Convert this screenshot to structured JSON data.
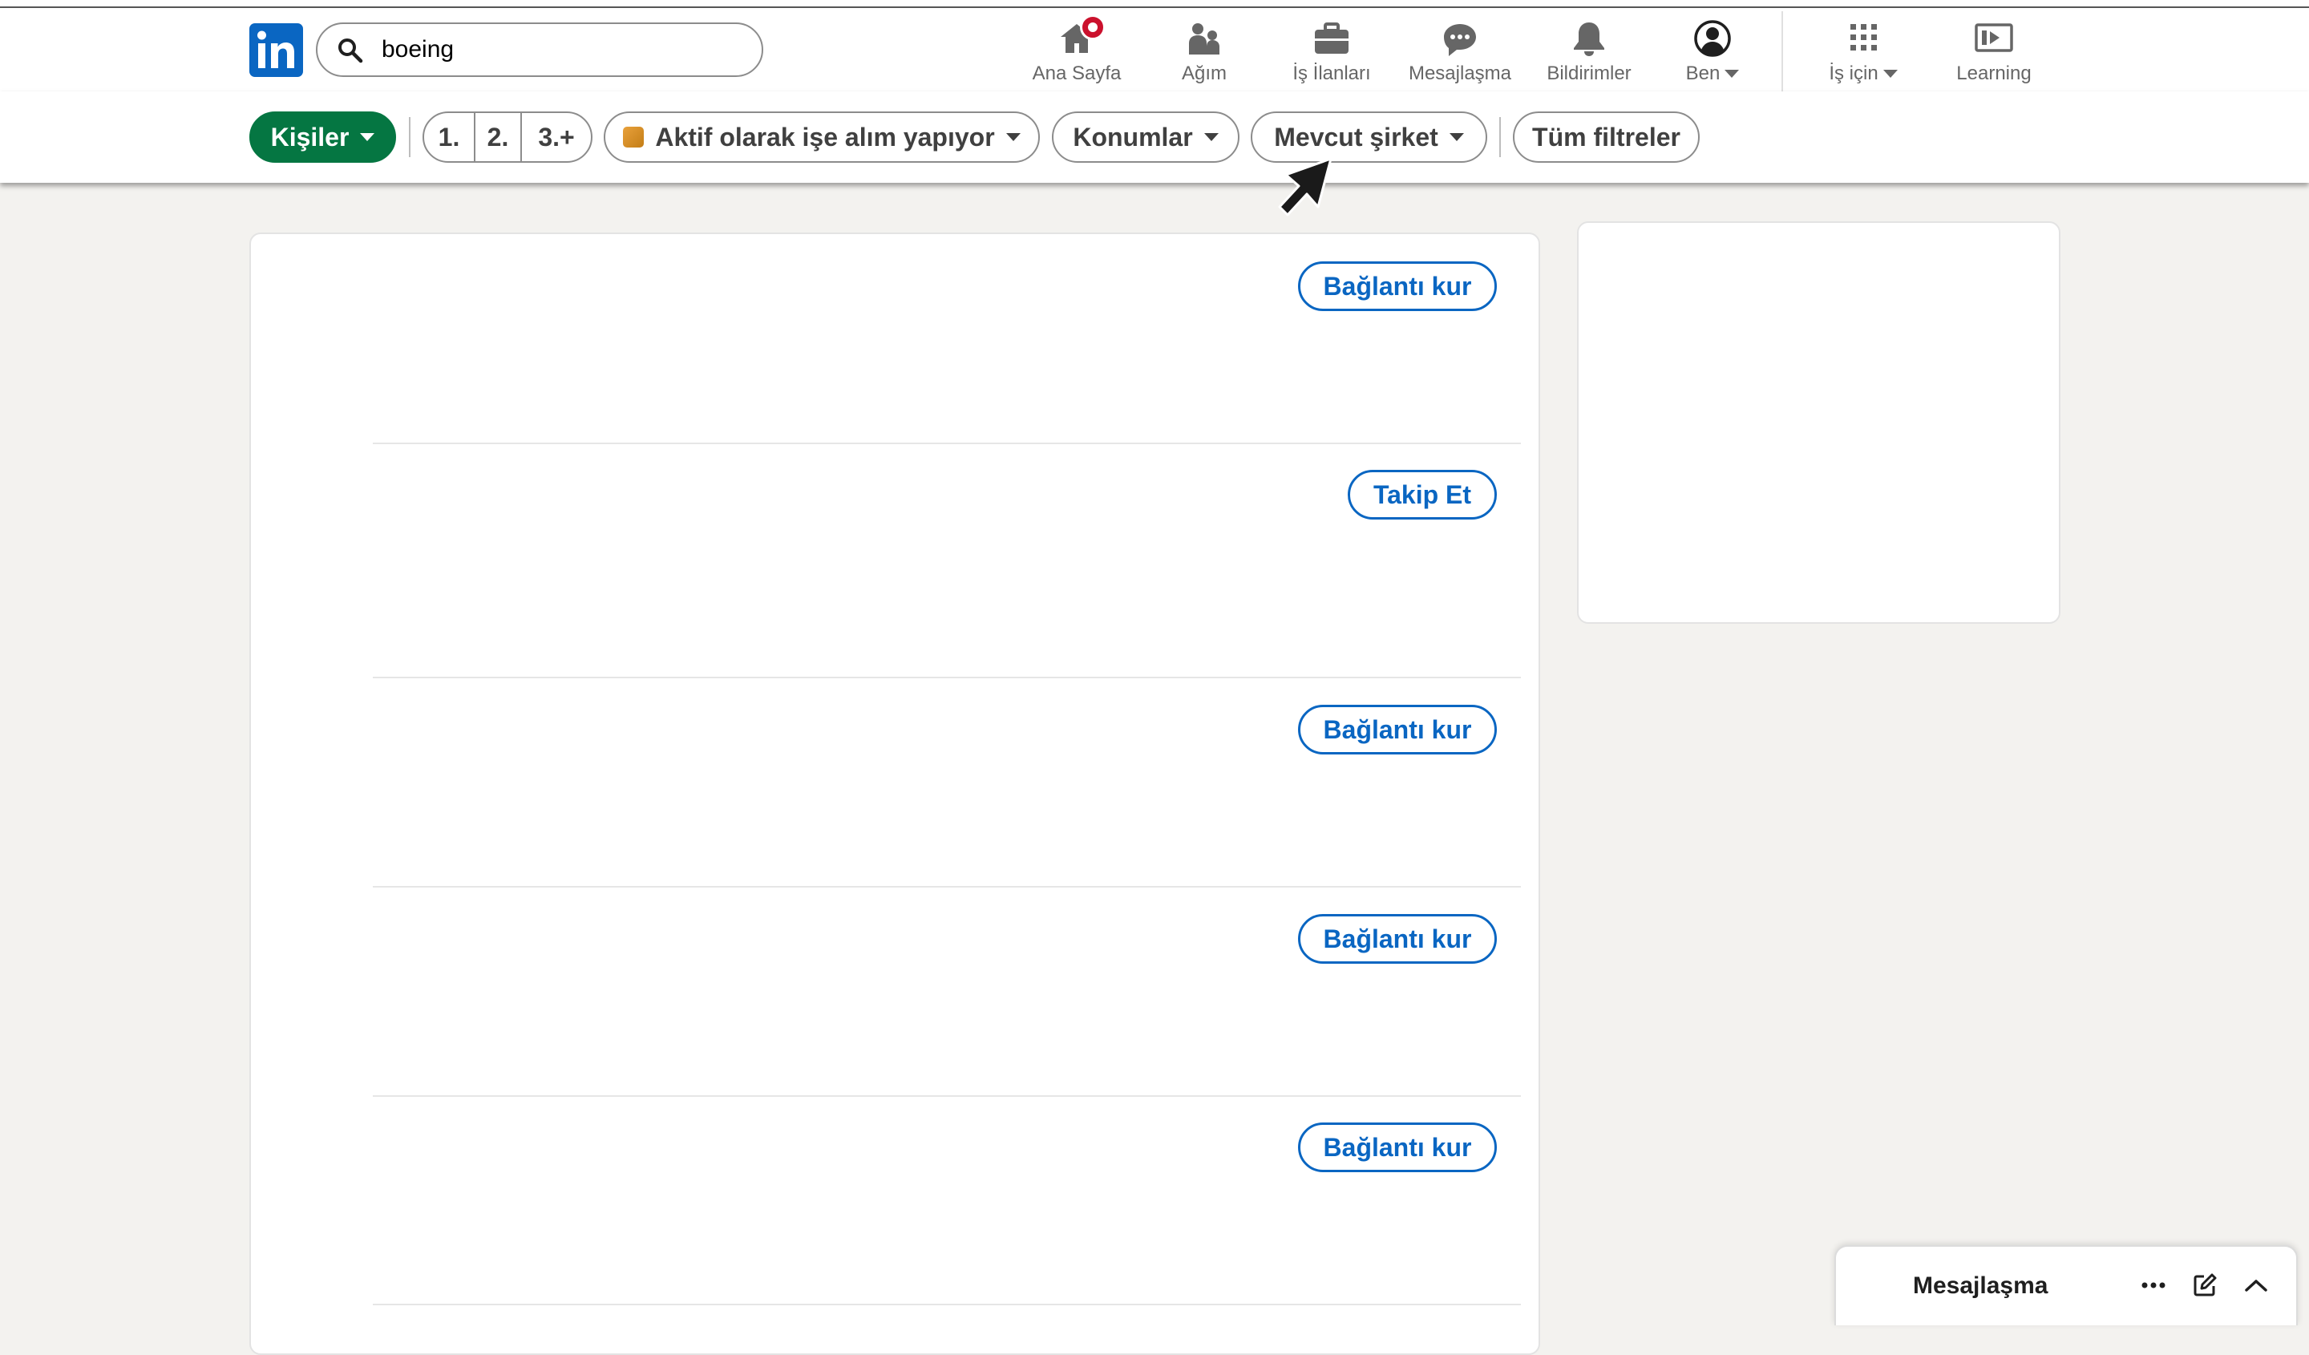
{
  "search": {
    "value": "boeing"
  },
  "nav": {
    "home": "Ana Sayfa",
    "network": "Ağım",
    "jobs": "İş İlanları",
    "messaging": "Mesajlaşma",
    "notifications": "Bildirimler",
    "me": "Ben",
    "business": "İş için",
    "learning": "Learning"
  },
  "filters": {
    "people": "Kişiler",
    "degree_1": "1.",
    "degree_2": "2.",
    "degree_3": "3.+",
    "actively_hiring": "Aktif olarak işe alım yapıyor",
    "locations": "Konumlar",
    "current_company": "Mevcut şirket",
    "all_filters": "Tüm filtreler"
  },
  "results": [
    {
      "action": "Bağlantı kur"
    },
    {
      "action": "Takip Et"
    },
    {
      "action": "Bağlantı kur"
    },
    {
      "action": "Bağlantı kur"
    },
    {
      "action": "Bağlantı kur"
    }
  ],
  "messaging_dock": {
    "title": "Mesajlaşma"
  },
  "colors": {
    "brand": "#0a66c2",
    "people_filter": "#057642",
    "notification": "#cb112d"
  },
  "icons": [
    "linkedin-logo",
    "search-icon",
    "home-icon",
    "network-icon",
    "briefcase-icon",
    "chat-icon",
    "bell-icon",
    "user-avatar-icon",
    "apps-grid-icon",
    "learning-icon",
    "more-icon",
    "compose-icon",
    "chevron-up-icon",
    "mouse-cursor"
  ]
}
